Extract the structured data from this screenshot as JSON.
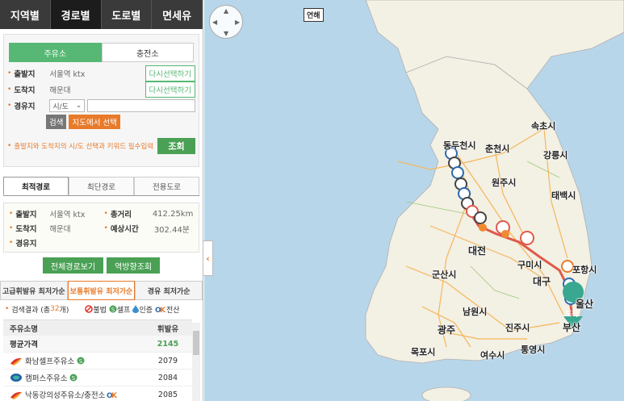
{
  "top_tabs": [
    "지역별",
    "경로별",
    "도로별",
    "면세유"
  ],
  "search": {
    "type_tabs": [
      "주유소",
      "충전소"
    ],
    "origin_label": "출발지",
    "origin_value": "서울역 ktx",
    "dest_label": "도착지",
    "dest_value": "해운대",
    "reselect_label": "다시선택하기",
    "waypoint_label": "경유지",
    "region_select": "시/도",
    "search_btn": "검색",
    "map_select_btn": "지도에서 선택",
    "notice": "출발지와 도착지의 시/도 선택과 키워드 필수입력",
    "query_btn": "조회"
  },
  "route_tabs": [
    "최적경로",
    "최단경로",
    "전용도로"
  ],
  "summary": {
    "origin_label": "출발지",
    "origin_value": "서울역 ktx",
    "distance_label": "총거리",
    "distance_value": "412.25km",
    "dest_label": "도착지",
    "dest_value": "해운대",
    "time_label": "예상시간",
    "time_value": "302.44분",
    "waypoint_label": "경유지",
    "full_route_btn": "전체경로보기",
    "reverse_btn": "역방향조회"
  },
  "fuel_tabs": [
    "고급휘발유 최저가순",
    "보통휘발유 최저가순",
    "경유 최저가순"
  ],
  "results": {
    "prefix": "검색결과 (총 ",
    "count": "32",
    "suffix": "개)",
    "legend": [
      "불법",
      "셀프",
      "인증",
      "전산"
    ]
  },
  "table": {
    "col_name": "주유소명",
    "col_price": "휘발유",
    "avg_label": "평균가격",
    "avg_price": "2145",
    "rows": [
      {
        "name": "화남셀프주유소",
        "price": "2079",
        "brand": "SK"
      },
      {
        "name": "캠퍼스주유소",
        "price": "2084",
        "brand": "HD"
      },
      {
        "name": "낙동강의성주유소/충전소",
        "price": "2085",
        "brand": "SK"
      }
    ]
  },
  "map": {
    "region_tag": "연해",
    "cities": [
      "동두천시",
      "춘천시",
      "속초시",
      "강릉시",
      "원주시",
      "태백시",
      "대전",
      "구미시",
      "대구",
      "포항시",
      "울산",
      "부산",
      "군산시",
      "남원시",
      "광주",
      "진주시",
      "목포시",
      "여수시",
      "통영시",
      "도착"
    ]
  },
  "colors": {
    "accent_green": "#4aa055",
    "accent_orange": "#e87a2a",
    "route": "#e05a4a",
    "sea": "#b8d6ea",
    "land": "#f3f0e4"
  }
}
